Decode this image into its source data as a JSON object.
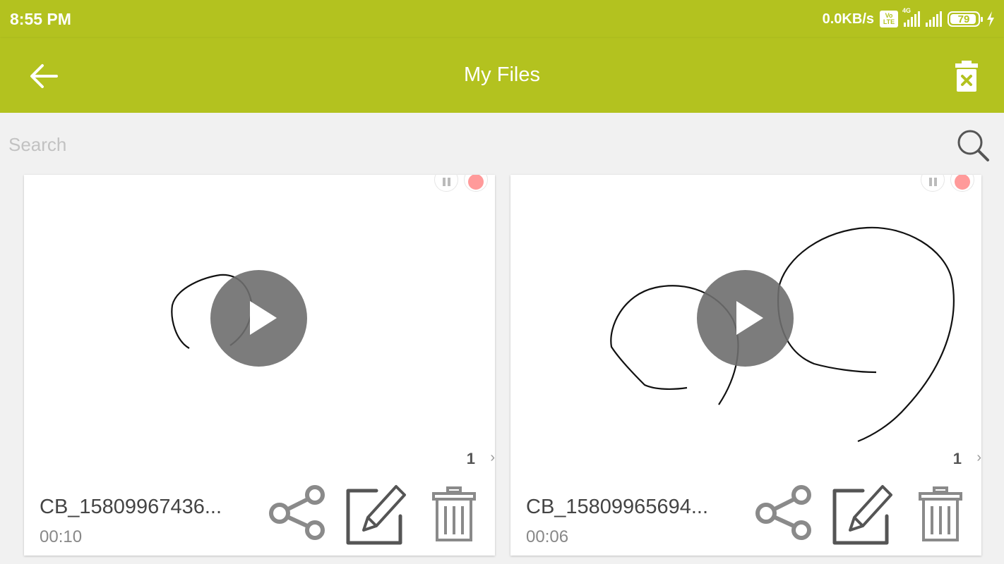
{
  "status_bar": {
    "time": "8:55 PM",
    "network_speed": "0.0KB/s",
    "volte_top": "Vo",
    "volte_bottom": "LTE",
    "network_type": "4G",
    "battery_level": "79"
  },
  "app_bar": {
    "title": "My Files",
    "back_icon": "arrow-left-icon",
    "delete_all_icon": "trash-x-icon"
  },
  "search": {
    "placeholder": "Search",
    "value": "",
    "icon": "search-icon"
  },
  "files": [
    {
      "name": "CB_15809967436...",
      "duration": "00:10",
      "page": "1",
      "next": "›"
    },
    {
      "name": "CB_15809965694...",
      "duration": "00:06",
      "page": "1",
      "next": "›"
    }
  ],
  "colors": {
    "accent": "#b3c21f",
    "background": "#f1f1f1",
    "play_overlay": "#6e6e6e",
    "action_icons": "#8a8a8a"
  }
}
